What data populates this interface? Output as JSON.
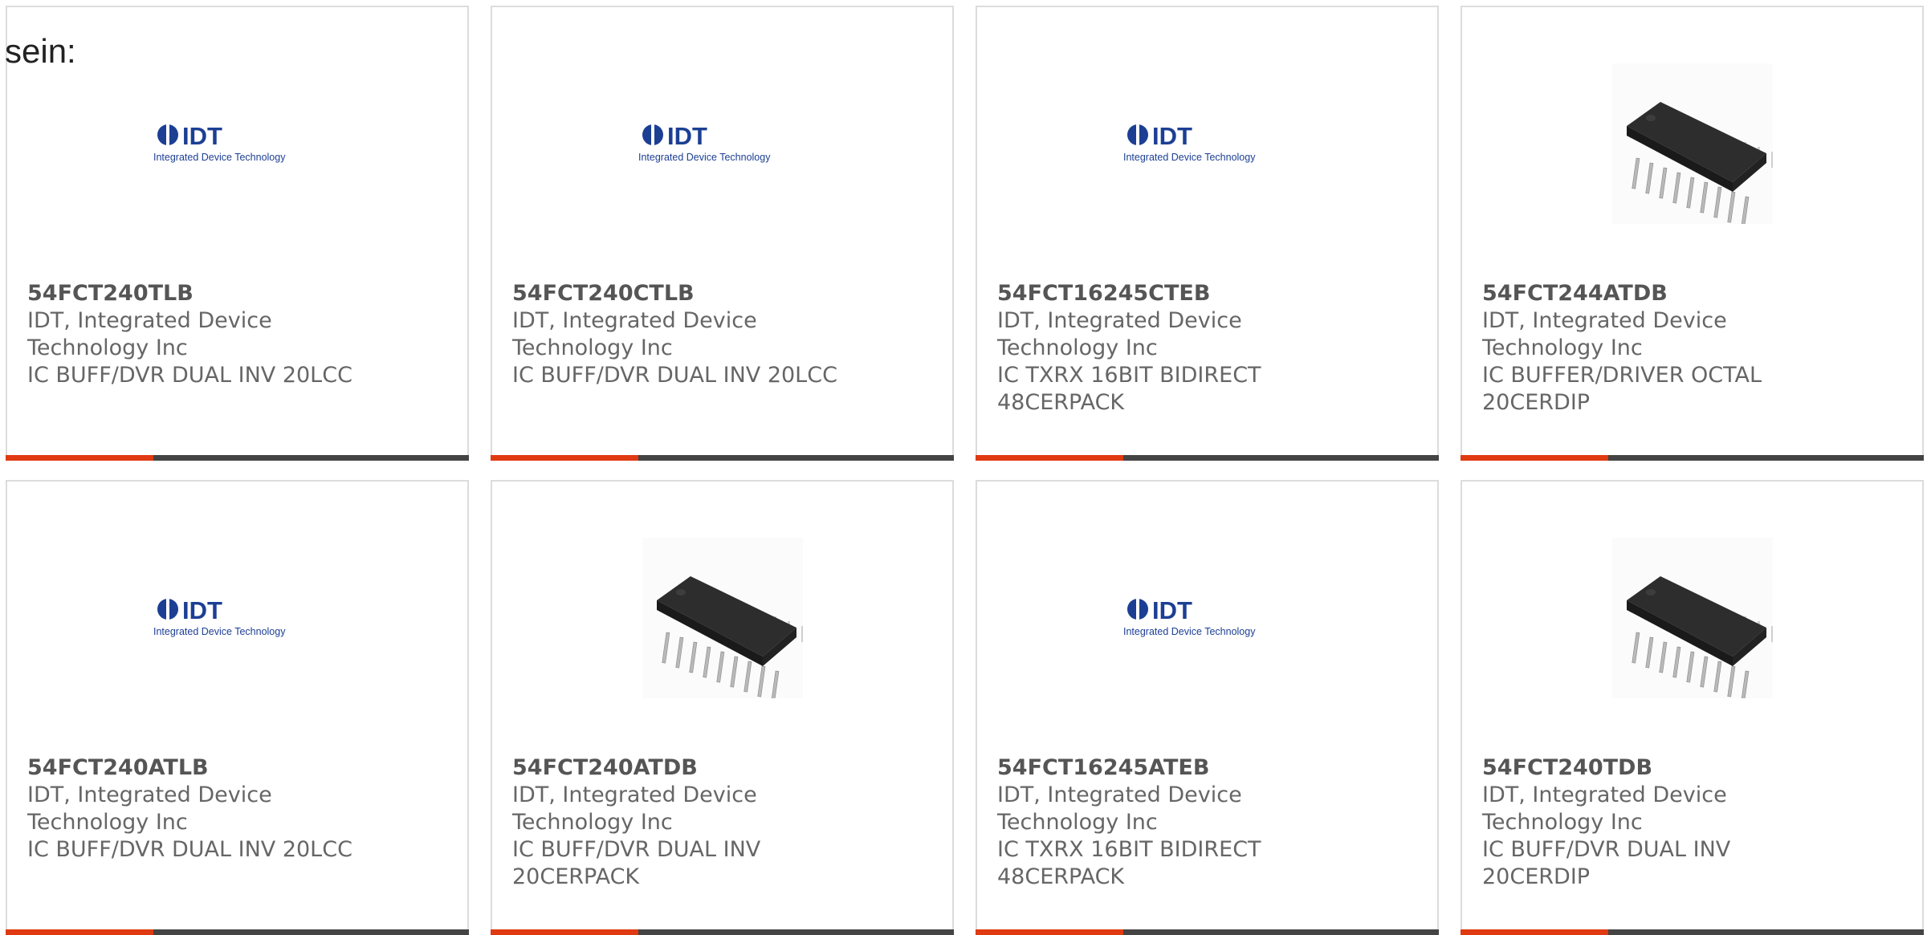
{
  "intro_text": "sein:",
  "products": [
    {
      "part": "54FCT240TLB",
      "manufacturer": "IDT, Integrated Device Technology Inc",
      "description": "IC BUFF/DVR DUAL INV 20LCC",
      "image": "idt-logo"
    },
    {
      "part": "54FCT240CTLB",
      "manufacturer": "IDT, Integrated Device Technology Inc",
      "description": "IC BUFF/DVR DUAL INV 20LCC",
      "image": "idt-logo"
    },
    {
      "part": "54FCT16245CTEB",
      "manufacturer": "IDT, Integrated Device Technology Inc",
      "description": "IC TXRX 16BIT BIDIRECT 48CERPACK",
      "image": "idt-logo"
    },
    {
      "part": "54FCT244ATDB",
      "manufacturer": "IDT, Integrated Device Technology Inc",
      "description": "IC BUFFER/DRIVER OCTAL 20CERDIP",
      "image": "dip-chip"
    },
    {
      "part": "54FCT240ATLB",
      "manufacturer": "IDT, Integrated Device Technology Inc",
      "description": "IC BUFF/DVR DUAL INV 20LCC",
      "image": "idt-logo"
    },
    {
      "part": "54FCT240ATDB",
      "manufacturer": "IDT, Integrated Device Technology Inc",
      "description": "IC BUFF/DVR DUAL INV 20CERPACK",
      "image": "dip-chip"
    },
    {
      "part": "54FCT16245ATEB",
      "manufacturer": "IDT, Integrated Device Technology Inc",
      "description": "IC TXRX 16BIT BIDIRECT 48CERPACK",
      "image": "idt-logo"
    },
    {
      "part": "54FCT240TDB",
      "manufacturer": "IDT, Integrated Device Technology Inc",
      "description": "IC BUFF/DVR DUAL INV 20CERDIP",
      "image": "dip-chip"
    }
  ],
  "logo": {
    "mark": "IDT",
    "tagline": "Integrated Device Technology"
  },
  "colors": {
    "accent": "#e03a12",
    "bar": "#444444",
    "logo_blue": "#1c3f94"
  }
}
